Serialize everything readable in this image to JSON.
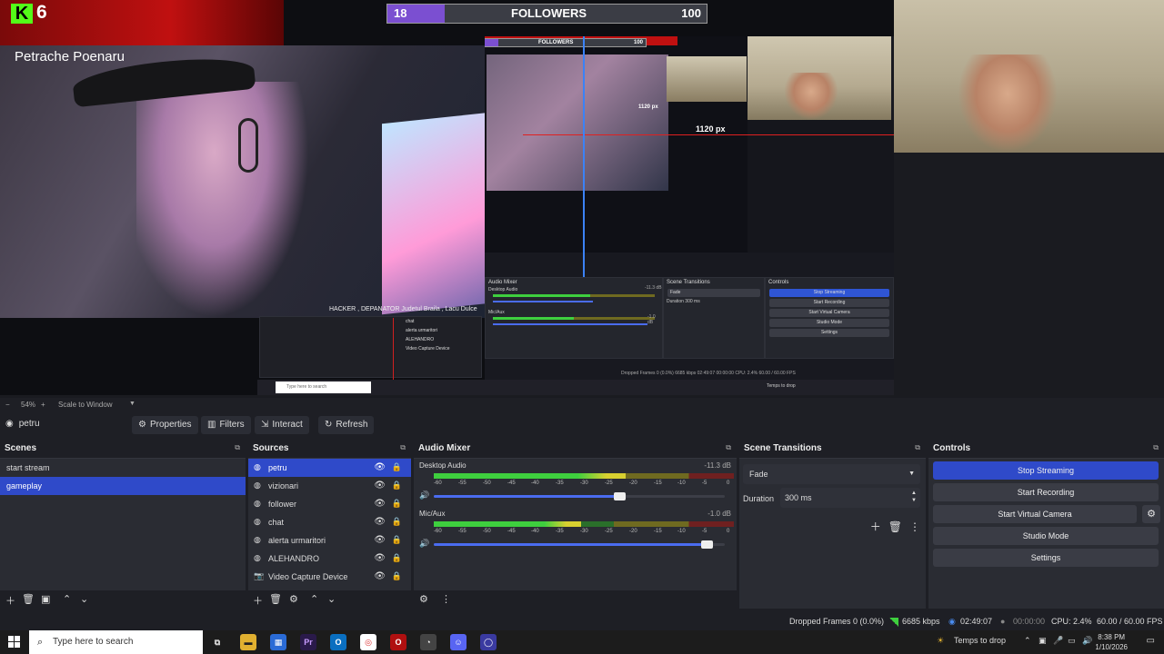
{
  "preview": {
    "kick_count": "6",
    "kick_logo": "K",
    "streamer_name": "Petrache Poenaru",
    "followers_left": "18",
    "followers_label": "FOLLOWERS",
    "followers_right": "100",
    "followers_fill_fraction": 0.18,
    "nested_followers_left": "18",
    "nested_followers_label": "FOLLOWERS",
    "nested_followers_right": "100",
    "px_label_large": "1120 px",
    "px_label_small": "1120 px",
    "caption": "HACKER , DEPANATOR Judetul Braila , Lacu Dulce",
    "mini_panels": {
      "audio_mixer": "Audio Mixer",
      "scene_transitions": "Scene Transitions",
      "controls": "Controls",
      "stop_streaming": "Stop Streaming",
      "start_recording": "Start Recording",
      "start_virtual_camera": "Start Virtual Camera",
      "studio_mode": "Studio Mode",
      "settings": "Settings",
      "fade": "Fade",
      "duration": "Duration",
      "duration_val": "300 ms",
      "desktop_audio": "Desktop Audio",
      "desktop_db": "-11.3 dB",
      "mic_aux": "Mic/Aux",
      "mic_db": "-1.0 dB",
      "search_placeholder": "Type here to search",
      "temps": "Temps to drop",
      "stats": "Dropped Frames 0 (0.0%)   6685 kbps   02:49:07   00:00:00   CPU: 2.4%   60.00 / 60.00 FPS"
    },
    "mini_sources": [
      "chat",
      "alerta urmaritori",
      "ALEHANDRO",
      "Video Capture Device"
    ]
  },
  "zoom": {
    "minus": "−",
    "percent": "54%",
    "plus": "+",
    "scale_mode": "Scale to Window"
  },
  "source_toolbar": {
    "selected_source": "petru",
    "properties": "Properties",
    "filters": "Filters",
    "interact": "Interact",
    "refresh": "Refresh"
  },
  "scenes": {
    "title": "Scenes",
    "items": [
      {
        "label": "start stream",
        "selected": false
      },
      {
        "label": "gameplay",
        "selected": true
      }
    ]
  },
  "sources": {
    "title": "Sources",
    "items": [
      {
        "label": "petru",
        "selected": true
      },
      {
        "label": "vizionari",
        "selected": false
      },
      {
        "label": "follower",
        "selected": false
      },
      {
        "label": "chat",
        "selected": false
      },
      {
        "label": "alerta urmaritori",
        "selected": false
      },
      {
        "label": "ALEHANDRO",
        "selected": false
      },
      {
        "label": "Video Capture Device",
        "selected": false
      }
    ]
  },
  "audio_mixer": {
    "title": "Audio Mixer",
    "channels": [
      {
        "name": "Desktop Audio",
        "db": "-11.3 dB",
        "level": 0.64,
        "volume": 0.64
      },
      {
        "name": "Mic/Aux",
        "db": "-1.0 dB",
        "level": 0.49,
        "volume": 0.94
      }
    ],
    "scale": [
      "-60",
      "-55",
      "-50",
      "-45",
      "-40",
      "-35",
      "-30",
      "-25",
      "-20",
      "-15",
      "-10",
      "-5",
      "0"
    ]
  },
  "transitions": {
    "title": "Scene Transitions",
    "selected": "Fade",
    "duration_label": "Duration",
    "duration_value": "300 ms"
  },
  "controls": {
    "title": "Controls",
    "stop_streaming": "Stop Streaming",
    "start_recording": "Start Recording",
    "start_virtual_camera": "Start Virtual Camera",
    "studio_mode": "Studio Mode",
    "settings": "Settings"
  },
  "status": {
    "dropped_frames": "Dropped Frames 0 (0.0%)",
    "bitrate": "6685 kbps",
    "stream_time": "02:49:07",
    "rec_time": "00:00:00",
    "cpu": "CPU: 2.4%",
    "fps": "60.00 / 60.00 FPS"
  },
  "taskbar": {
    "search_placeholder": "Type here to search",
    "weather": "Temps to drop",
    "time": "8:38 PM",
    "date": "1/10/2026"
  },
  "colors": {
    "accent": "#2f4ac9",
    "followers_fill": "#7b4fd1",
    "kick_green": "#53fc18",
    "status_green": "#3ecf3e"
  }
}
